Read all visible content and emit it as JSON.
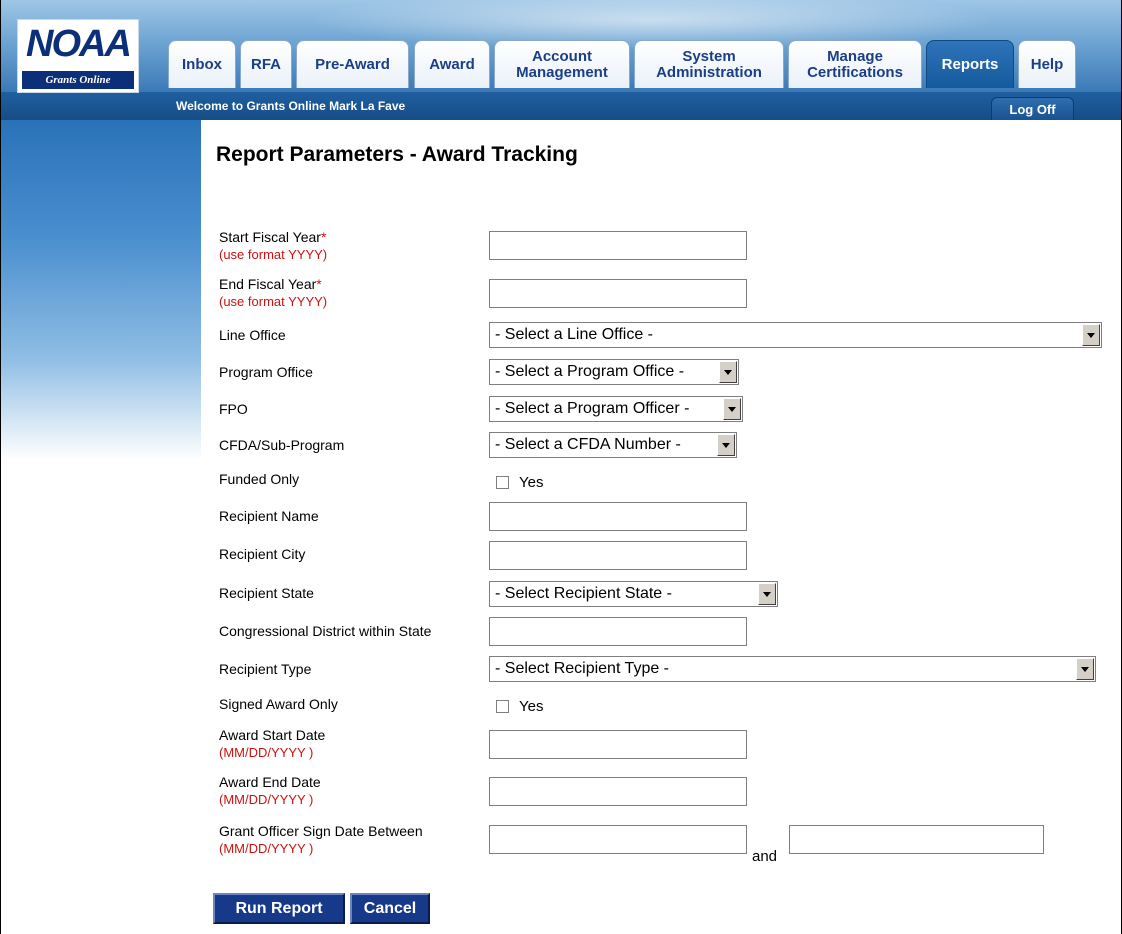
{
  "logo": {
    "main": "NOAA",
    "subtitle": "Grants Online"
  },
  "tabs": [
    {
      "label": "Inbox"
    },
    {
      "label": "RFA"
    },
    {
      "label": "Pre-Award"
    },
    {
      "label": "Award"
    },
    {
      "label": "Account Management"
    },
    {
      "label": "System Administration"
    },
    {
      "label": "Manage Certifications"
    },
    {
      "label": "Reports"
    },
    {
      "label": "Help"
    }
  ],
  "header": {
    "welcome": "Welcome to Grants Online Mark La Fave",
    "logoff_label": "Log Off"
  },
  "page": {
    "title": "Report Parameters - Award Tracking"
  },
  "form": {
    "start_fiscal_year": {
      "label": "Start Fiscal Year",
      "required": "*",
      "hint": "(use format YYYY)",
      "value": ""
    },
    "end_fiscal_year": {
      "label": "End Fiscal Year",
      "required": "*",
      "hint": "(use format YYYY)",
      "value": ""
    },
    "line_office": {
      "label": "Line Office",
      "selected": "- Select a Line Office -"
    },
    "program_office": {
      "label": "Program Office",
      "selected": "- Select a Program Office -"
    },
    "fpo": {
      "label": "FPO",
      "selected": "- Select a Program Officer -"
    },
    "cfda": {
      "label": "CFDA/Sub-Program",
      "selected": "- Select a CFDA Number -"
    },
    "funded_only": {
      "label": "Funded Only",
      "option": "Yes",
      "checked": false
    },
    "recipient_name": {
      "label": "Recipient Name",
      "value": ""
    },
    "recipient_city": {
      "label": "Recipient City",
      "value": ""
    },
    "recipient_state": {
      "label": "Recipient State",
      "selected": "- Select Recipient State -"
    },
    "congressional_district": {
      "label": "Congressional District within State",
      "value": ""
    },
    "recipient_type": {
      "label": "Recipient Type",
      "selected": "- Select Recipient Type -"
    },
    "signed_award_only": {
      "label": "Signed Award Only",
      "option": "Yes",
      "checked": false
    },
    "award_start_date": {
      "label": "Award Start Date",
      "hint": "(MM/DD/YYYY )",
      "value": ""
    },
    "award_end_date": {
      "label": "Award End Date",
      "hint": "(MM/DD/YYYY )",
      "value": ""
    },
    "grant_officer_sign_date": {
      "label": "Grant Officer Sign Date Between",
      "hint": "(MM/DD/YYYY )",
      "and_label": "and",
      "from": "",
      "to": ""
    }
  },
  "buttons": {
    "run_report": "Run Report",
    "cancel": "Cancel"
  },
  "colors": {
    "tab_text": "#1b3f86",
    "active_tab": "#155a9c",
    "required": "#d01010",
    "button": "#17398a",
    "header_bar": "#174d86"
  }
}
